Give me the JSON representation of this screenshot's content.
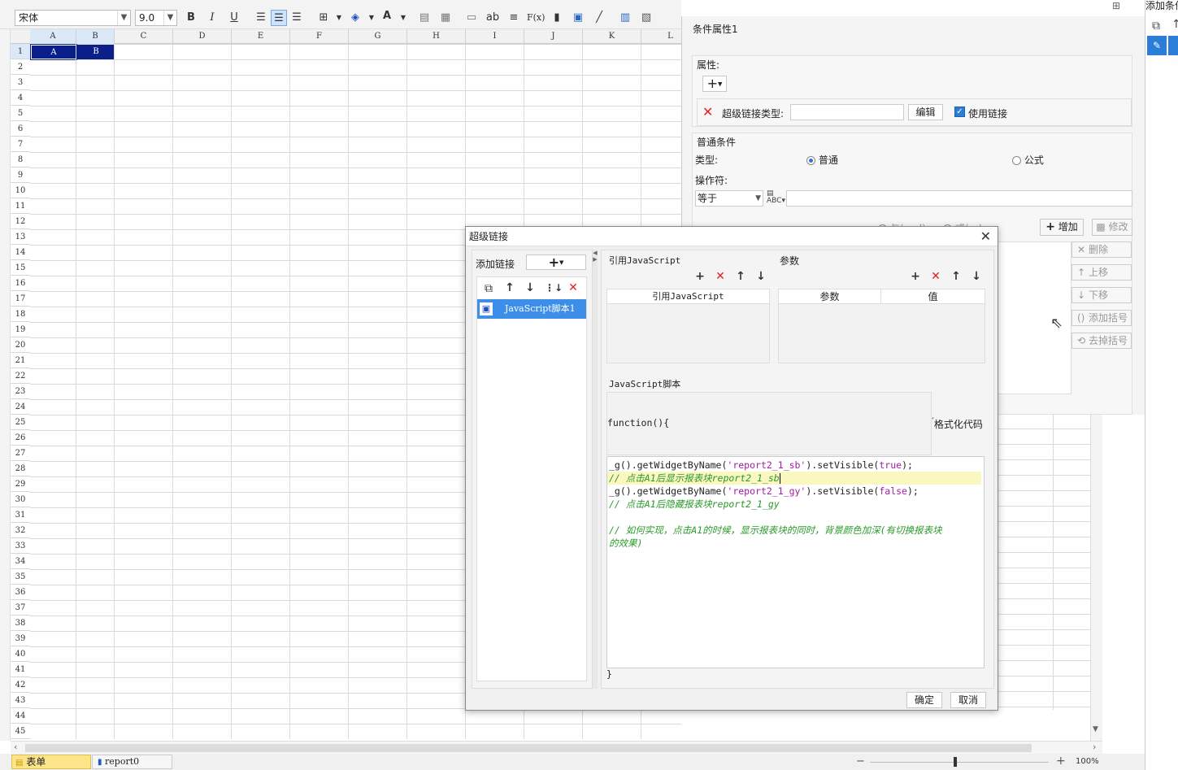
{
  "toolbar": {
    "font_name": "宋体",
    "font_size": "9.0",
    "bold_label": "B",
    "italic_label": "I",
    "underline_label": "U",
    "font_color_label": "A",
    "text_label": "ab",
    "formula_label": "F(x)"
  },
  "sheet": {
    "columns": [
      "A",
      "B",
      "C",
      "D",
      "E",
      "F",
      "G",
      "H",
      "I",
      "J",
      "K",
      "L"
    ],
    "rows": [
      "1",
      "2",
      "3",
      "4",
      "5",
      "6",
      "7",
      "8",
      "9",
      "10",
      "11",
      "12",
      "13",
      "14",
      "15",
      "16",
      "17",
      "18",
      "19",
      "20",
      "21",
      "22",
      "23",
      "24",
      "25",
      "26",
      "27",
      "28",
      "29",
      "30",
      "31",
      "32",
      "33",
      "34",
      "35",
      "36",
      "37",
      "38",
      "39",
      "40",
      "41",
      "42",
      "43",
      "44",
      "45"
    ],
    "cell_a1": "A",
    "cell_b1": "B"
  },
  "bottom_tabs": {
    "form_tab": "表单",
    "report_tab": "report0"
  },
  "zoom": {
    "minus": "−",
    "plus": "+",
    "level": "100%"
  },
  "condition_panel": {
    "title": "条件属性1",
    "attributes_label": "属性:",
    "hyperlink_type_label": "超级链接类型:",
    "edit_button": "编辑",
    "use_link_label": "使用链接",
    "use_link_checked": true,
    "normal_condition_label": "普通条件",
    "type_label": "类型:",
    "type_normal": "普通",
    "type_formula": "公式",
    "operator_label": "操作符:",
    "operator_value": "等于",
    "add_button": "增加",
    "modify_button": "修改",
    "delete_button": "删除",
    "move_up_button": "上移",
    "move_down_button": "下移",
    "add_bracket_button": "添加括号",
    "remove_bracket_button": "去掉括号",
    "and_label": "与(and)",
    "or_label": "或(or)"
  },
  "far_right": {
    "title": "添加条件"
  },
  "dialog": {
    "title": "超级链接",
    "add_link_label": "添加链接",
    "link_items": [
      "JavaScript脚本1"
    ],
    "ref_js_section": "引用JavaScript",
    "ref_js_column": "引用JavaScript",
    "params_section": "参数",
    "params_column": "参数",
    "value_column": "值",
    "js_script_section": "JavaScript脚本",
    "function_header": "function(){",
    "format_code_label": "格式化代码",
    "closing_brace": "}",
    "ok_button": "确定",
    "cancel_button": "取消",
    "code_lines": [
      {
        "pre": "_g().getWidgetByName(",
        "str": "'report2_1_sb'",
        "mid": ").setVisible(",
        "kw": "true",
        "post": ");"
      },
      {
        "comment": "// 点击A1后显示报表块report2_1_sb"
      },
      {
        "pre": "_g().getWidgetByName(",
        "str": "'report2_1_gy'",
        "mid": ").setVisible(",
        "kw": "false",
        "post": ");"
      },
      {
        "comment": "// 点击A1后隐藏报表块report2_1_gy"
      },
      {
        "comment": ""
      },
      {
        "comment": "// 如何实现，点击A1的时候，显示报表块的同时，背景颜色加深(有切换报表块"
      },
      {
        "comment": "的效果)"
      }
    ]
  },
  "colors": {
    "selection": "#0a1f8a",
    "list_selected": "#3d8ee8",
    "highlight_line": "#fbf7c0",
    "delete_red": "#e02020"
  }
}
